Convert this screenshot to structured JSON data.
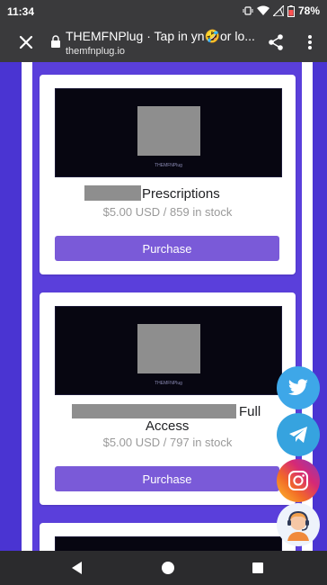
{
  "status_bar": {
    "time": "11:34",
    "battery": "78%"
  },
  "browser": {
    "title": "THEMFNPlug · Tap in yn🤣or lo...",
    "url": "themfnplug.io"
  },
  "products": [
    {
      "banner_brand": "THEMFNPlug",
      "name_visible": "Prescriptions",
      "price_stock": "$5.00 USD / 859 in stock",
      "button_label": "Purchase"
    },
    {
      "banner_brand": "THEMFNPlug",
      "name_visible_1": "Full",
      "name_visible_2": "Access",
      "price_stock": "$5.00 USD / 797 in stock",
      "button_label": "Purchase"
    }
  ],
  "floating_buttons": [
    "twitter-icon",
    "telegram-icon",
    "instagram-icon",
    "support-agent-icon"
  ],
  "colors": {
    "page_purple": "#4a34d2",
    "button_purple": "#7a5ad8",
    "twitter": "#3ea7e8",
    "telegram": "#36a3df"
  }
}
